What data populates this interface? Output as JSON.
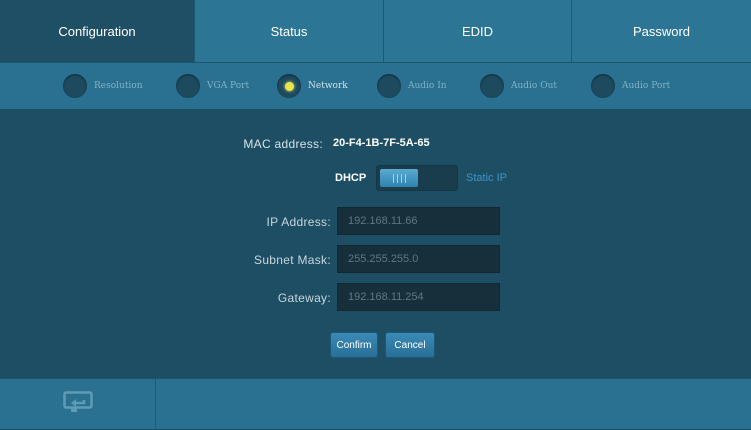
{
  "tabs": [
    {
      "label": "Configuration",
      "active": true
    },
    {
      "label": "Status",
      "active": false
    },
    {
      "label": "EDID",
      "active": false
    },
    {
      "label": "Password",
      "active": false
    }
  ],
  "subnav": [
    {
      "label": "Resolution",
      "active": false
    },
    {
      "label": "VGA Port",
      "active": false
    },
    {
      "label": "Network",
      "active": true
    },
    {
      "label": "Audio In",
      "active": false
    },
    {
      "label": "Audio Out",
      "active": false
    },
    {
      "label": "Audio Port",
      "active": false
    }
  ],
  "network": {
    "mac_label": "MAC address:",
    "mac_value": "20-F4-1B-7F-5A-65",
    "dhcp_label": "DHCP",
    "static_label": "Static IP",
    "mode": "DHCP",
    "ip_label": "IP Address:",
    "ip_value": "192.168.11.66",
    "subnet_label": "Subnet Mask:",
    "subnet_value": "255.255.255.0",
    "gateway_label": "Gateway:",
    "gateway_value": "192.168.11.254",
    "confirm_label": "Confirm",
    "cancel_label": "Cancel"
  },
  "footer": {
    "back_icon": "return-icon"
  },
  "colors": {
    "background": "#1e4e63",
    "bar": "#2c7595",
    "active_tab": "#1f4f64",
    "active_led": "#e8e64a",
    "accent": "#3b95c6"
  }
}
